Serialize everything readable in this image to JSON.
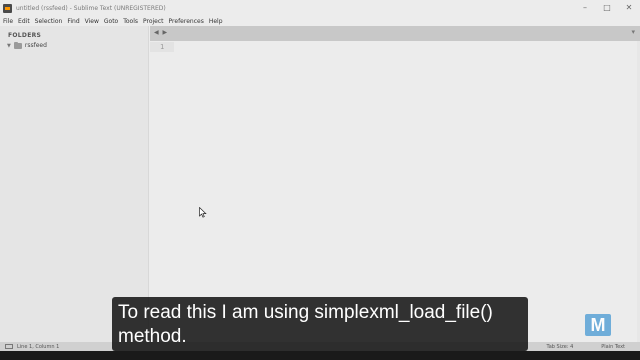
{
  "window": {
    "title": "untitled (rssfeed) - Sublime Text (UNREGISTERED)",
    "controls": {
      "minimize": "–",
      "maximize": "□",
      "close": "✕"
    }
  },
  "menu": [
    "File",
    "Edit",
    "Selection",
    "Find",
    "View",
    "Goto",
    "Tools",
    "Project",
    "Preferences",
    "Help"
  ],
  "sidebar": {
    "heading": "FOLDERS",
    "folder": {
      "arrow": "▼",
      "label": "rssfeed"
    }
  },
  "tabbar": {
    "nav": "◀ ▶",
    "menu": "▾"
  },
  "editor": {
    "line_numbers": [
      "1"
    ]
  },
  "status": {
    "position": "Line 1, Column 1",
    "tab_size": "Tab Size: 4",
    "syntax": "Plain Text"
  },
  "caption": {
    "line1": "To read this I am using simplexml_load_file()",
    "line2": "method."
  },
  "watermark": {
    "letter": "M",
    "color": "#5aa3d6"
  },
  "colors": {
    "app_bg": "#ececec",
    "sidebar_bg": "#e5e5e5",
    "tabbar_bg": "#c8c8c8",
    "statusbar_bg": "#d0d0d0"
  }
}
